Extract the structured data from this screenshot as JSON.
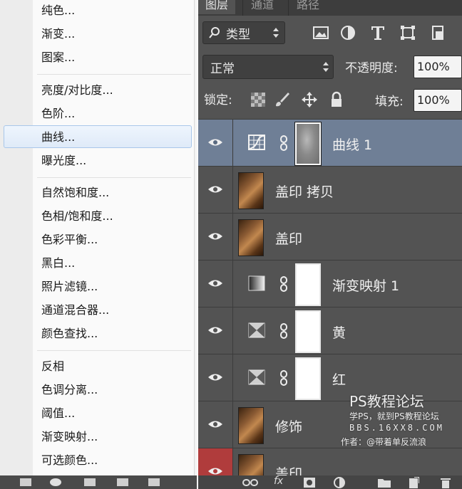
{
  "menu": {
    "groups": [
      [
        "纯色...",
        "渐变...",
        "图案..."
      ],
      [
        "亮度/对比度...",
        "色阶...",
        "曲线...",
        "曝光度..."
      ],
      [
        "自然饱和度...",
        "色相/饱和度...",
        "色彩平衡...",
        "黑白...",
        "照片滤镜...",
        "通道混合器...",
        "颜色查找..."
      ],
      [
        "反相",
        "色调分离...",
        "阈值...",
        "渐变映射...",
        "可选颜色..."
      ]
    ],
    "highlighted": "曲线..."
  },
  "panel": {
    "tabs": [
      "图层",
      "通道",
      "路径"
    ],
    "active_tab": "图层",
    "filter_kind": "类型",
    "blend_mode": "正常",
    "opacity_label": "不透明度:",
    "opacity_value": "100%",
    "lock_label": "锁定:",
    "fill_label": "填充:",
    "fill_value": "100%",
    "filter_icons": [
      "image-filter-icon",
      "adjustment-filter-icon",
      "type-filter-icon",
      "shape-filter-icon",
      "smart-object-filter-icon"
    ],
    "lock_icons": [
      "lock-transparent-icon",
      "lock-image-icon",
      "lock-position-icon",
      "lock-all-icon"
    ]
  },
  "layers": [
    {
      "name": "曲线 1",
      "kind": "curves",
      "selected": true
    },
    {
      "name": "盖印 拷贝",
      "kind": "photo",
      "selected": false
    },
    {
      "name": "盖印",
      "kind": "photo",
      "selected": false
    },
    {
      "name": "渐变映射 1",
      "kind": "gradient-map",
      "selected": false
    },
    {
      "name": "黄",
      "kind": "selective",
      "selected": false
    },
    {
      "name": "红",
      "kind": "selective",
      "selected": false
    },
    {
      "name": "修饰",
      "kind": "photo",
      "selected": false
    },
    {
      "name": "盖印",
      "kind": "photo",
      "selected": false
    }
  ],
  "watermark": {
    "title": "PS教程论坛",
    "line2": "学PS，就到PS教程论坛",
    "line3": "BBS.16XX8.COM",
    "line4": "作者：@带着单反流浪"
  },
  "colors": {
    "selected_row": "#6f7f96",
    "panel_bg": "#535353",
    "menu_highlight": "#dfeaf8"
  }
}
